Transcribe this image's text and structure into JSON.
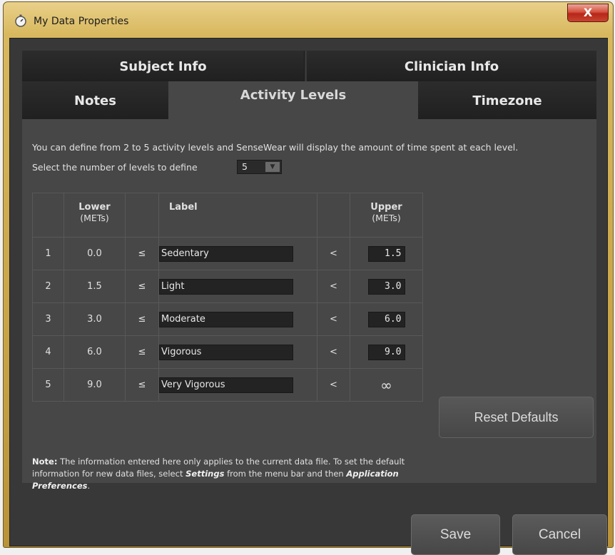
{
  "window": {
    "title": "My Data Properties",
    "app_icon": "stopwatch-icon",
    "close_label": "X",
    "frame_color": "#d4b25a"
  },
  "tabs": [
    {
      "label": "Subject Info",
      "selected": false
    },
    {
      "label": "Clinician Info",
      "selected": false
    },
    {
      "label": "Notes",
      "selected": false
    },
    {
      "label": "Activity Levels",
      "selected": true
    },
    {
      "label": "Timezone",
      "selected": false
    }
  ],
  "activity": {
    "description_line1": "You can define from 2 to 5 activity levels and SenseWear will display the amount of time spent at each level.",
    "select_label": "Select the number of levels to define",
    "levels_selected": "5",
    "table": {
      "headers": {
        "lower": "Lower",
        "lower_unit": "(METs)",
        "label": "Label",
        "upper": "Upper",
        "upper_unit": "(METs)"
      },
      "rows": [
        {
          "num": "1",
          "lower": "0.0",
          "le": "≤",
          "label": "Sedentary",
          "lt": "<",
          "upper": "1.5"
        },
        {
          "num": "2",
          "lower": "1.5",
          "le": "≤",
          "label": "Light",
          "lt": "<",
          "upper": "3.0"
        },
        {
          "num": "3",
          "lower": "3.0",
          "le": "≤",
          "label": "Moderate",
          "lt": "<",
          "upper": "6.0"
        },
        {
          "num": "4",
          "lower": "6.0",
          "le": "≤",
          "label": "Vigorous",
          "lt": "<",
          "upper": "9.0"
        },
        {
          "num": "5",
          "lower": "9.0",
          "le": "≤",
          "label": "Very Vigorous",
          "lt": "<",
          "upper": "∞"
        }
      ]
    },
    "reset_label": "Reset Defaults",
    "note": {
      "prefix": "Note:",
      "text1": " The information entered here only applies to the current data file. To set the default information for new data files, select ",
      "settings": "Settings",
      "text2": " from the menu bar and then ",
      "app_prefs": "Application Preferences",
      "text3": "."
    }
  },
  "footer": {
    "save_label": "Save",
    "cancel_label": "Cancel"
  }
}
